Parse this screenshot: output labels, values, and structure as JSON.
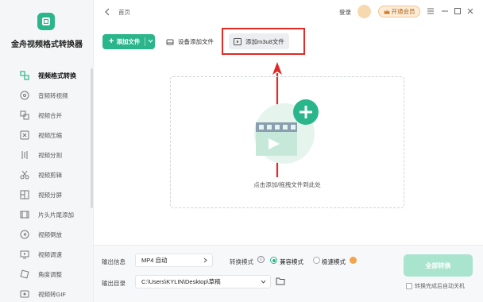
{
  "app": {
    "title": "金舟视频格式转换器"
  },
  "sidebar": {
    "items": [
      {
        "label": "视频格式转换",
        "icon": "convert-icon",
        "active": true
      },
      {
        "label": "音频转视频",
        "icon": "disc-icon"
      },
      {
        "label": "视频合并",
        "icon": "merge-icon"
      },
      {
        "label": "视频压缩",
        "icon": "compress-icon"
      },
      {
        "label": "视频分割",
        "icon": "split-icon"
      },
      {
        "label": "视频剪辑",
        "icon": "scissors-icon"
      },
      {
        "label": "视频分屏",
        "icon": "split-screen-icon"
      },
      {
        "label": "片头片尾添加",
        "icon": "film-icon"
      },
      {
        "label": "视频倒放",
        "icon": "reverse-icon"
      },
      {
        "label": "视频调速",
        "icon": "speed-icon"
      },
      {
        "label": "角度调整",
        "icon": "rotate-icon"
      },
      {
        "label": "视频转GIF",
        "icon": "gif-icon"
      }
    ]
  },
  "topbar": {
    "breadcrumb": "首页",
    "login": "登录",
    "vip": "开通会员"
  },
  "toolbar": {
    "add_file": "添加文件",
    "device_add": "设备添加文件",
    "add_m3u8": "添加m3u8文件"
  },
  "dropzone": {
    "hint": "点击添加/拖拽文件到此处"
  },
  "bottom": {
    "output_info_label": "输出信息",
    "output_format": "MP4 自动",
    "convert_mode_label": "转换模式",
    "mode_compatible": "兼容模式",
    "mode_fast": "极速模式",
    "output_dir_label": "输出目录",
    "output_dir": "C:\\Users\\KYLIN\\Desktop\\草稿",
    "convert_all": "全部转换",
    "shutdown_after": "转换完成后自动关机"
  },
  "colors": {
    "accent": "#2bb58a",
    "highlight": "#e02a26",
    "vip": "#b0651c"
  }
}
